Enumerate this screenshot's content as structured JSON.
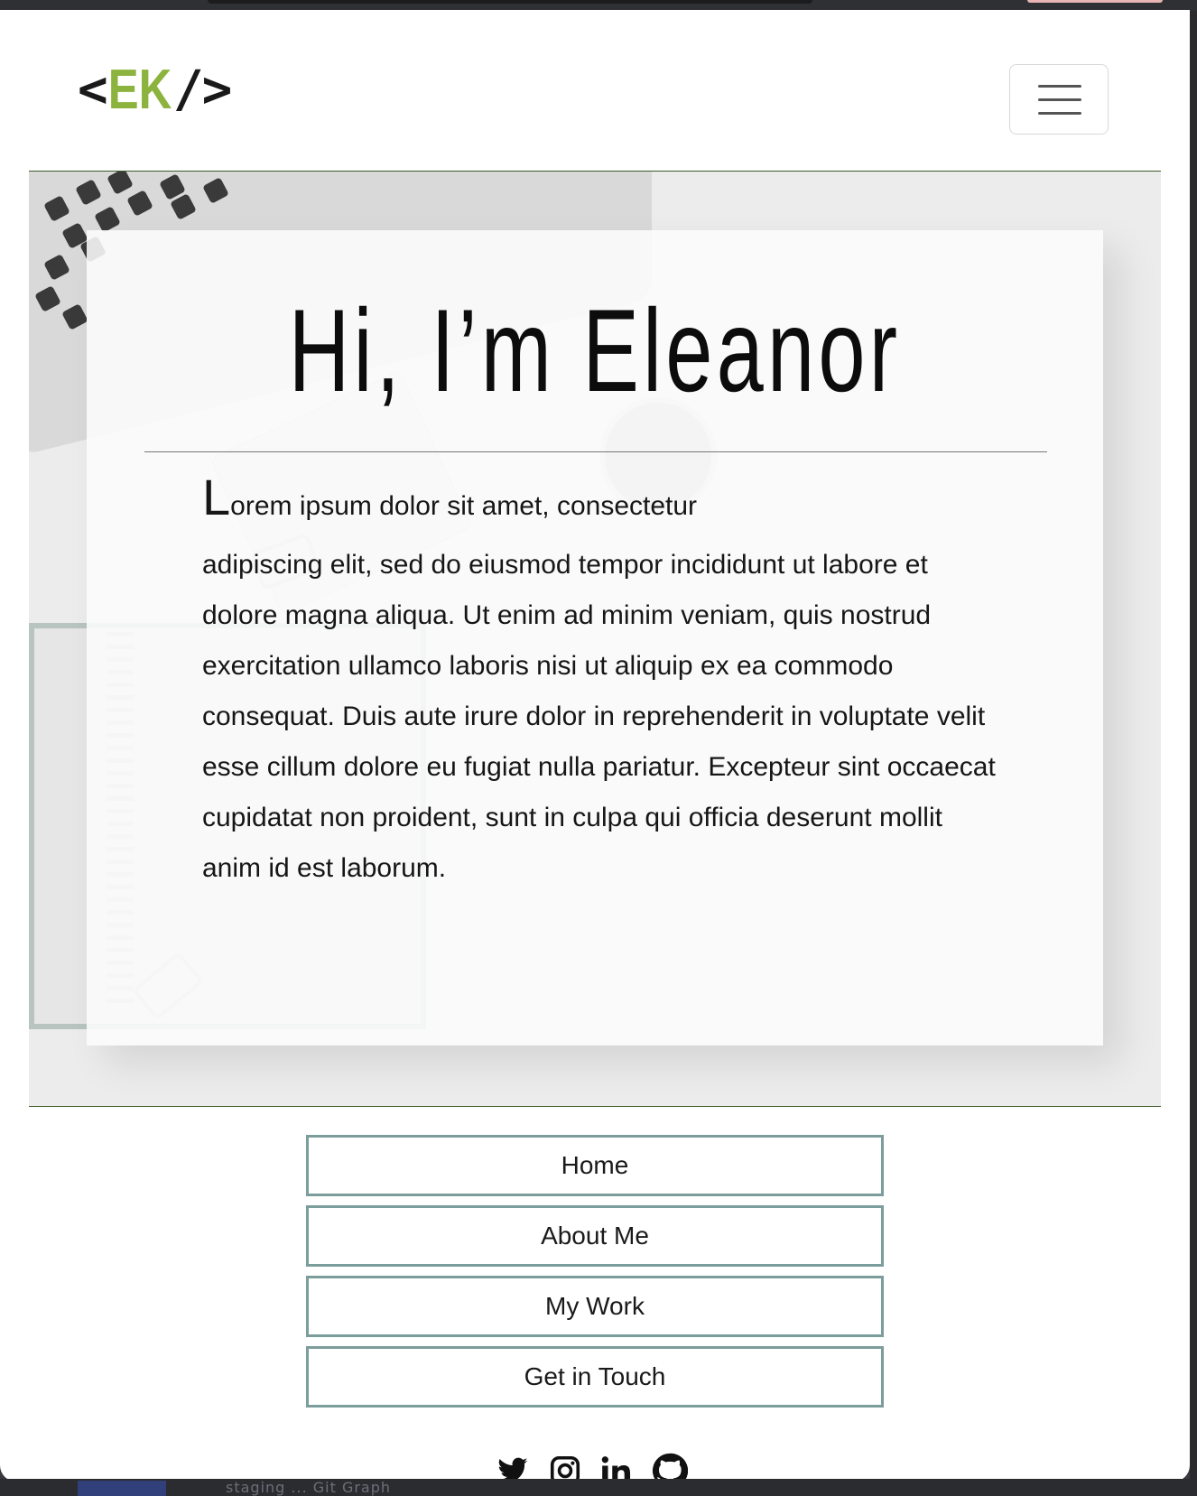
{
  "header": {
    "logo": {
      "open_bracket": "<",
      "initials": "EK",
      "slash": "/",
      "close_bracket": ">"
    },
    "menu_toggle_icon": "hamburger-icon"
  },
  "hero": {
    "title": "Hi, I’m Eleanor",
    "dropcap": "L",
    "first_line": "orem ipsum dolor sit amet, consectetur",
    "body": "adipiscing elit, sed do eiusmod tempor incididunt ut labore et dolore magna aliqua. Ut enim ad minim veniam, quis nostrud exercitation ullamco laboris nisi ut aliquip ex ea commodo consequat. Duis aute irure dolor in reprehenderit in voluptate velit esse cillum dolore eu fugiat nulla pariatur. Excepteur sint occaecat cupidatat non proident, sunt in culpa qui officia deserunt mollit anim id est laborum."
  },
  "nav": {
    "items": [
      {
        "label": "Home"
      },
      {
        "label": "About Me"
      },
      {
        "label": "My Work"
      },
      {
        "label": "Get in Touch"
      }
    ]
  },
  "social": {
    "icons": [
      "twitter-icon",
      "instagram-icon",
      "linkedin-icon",
      "github-icon"
    ]
  },
  "colors": {
    "accent_green": "#8db33f",
    "nav_border": "#7b9d9c",
    "hero_rule": "#3d5a2a"
  },
  "background_window": {
    "bottom_text": "staging ... Git Graph"
  }
}
